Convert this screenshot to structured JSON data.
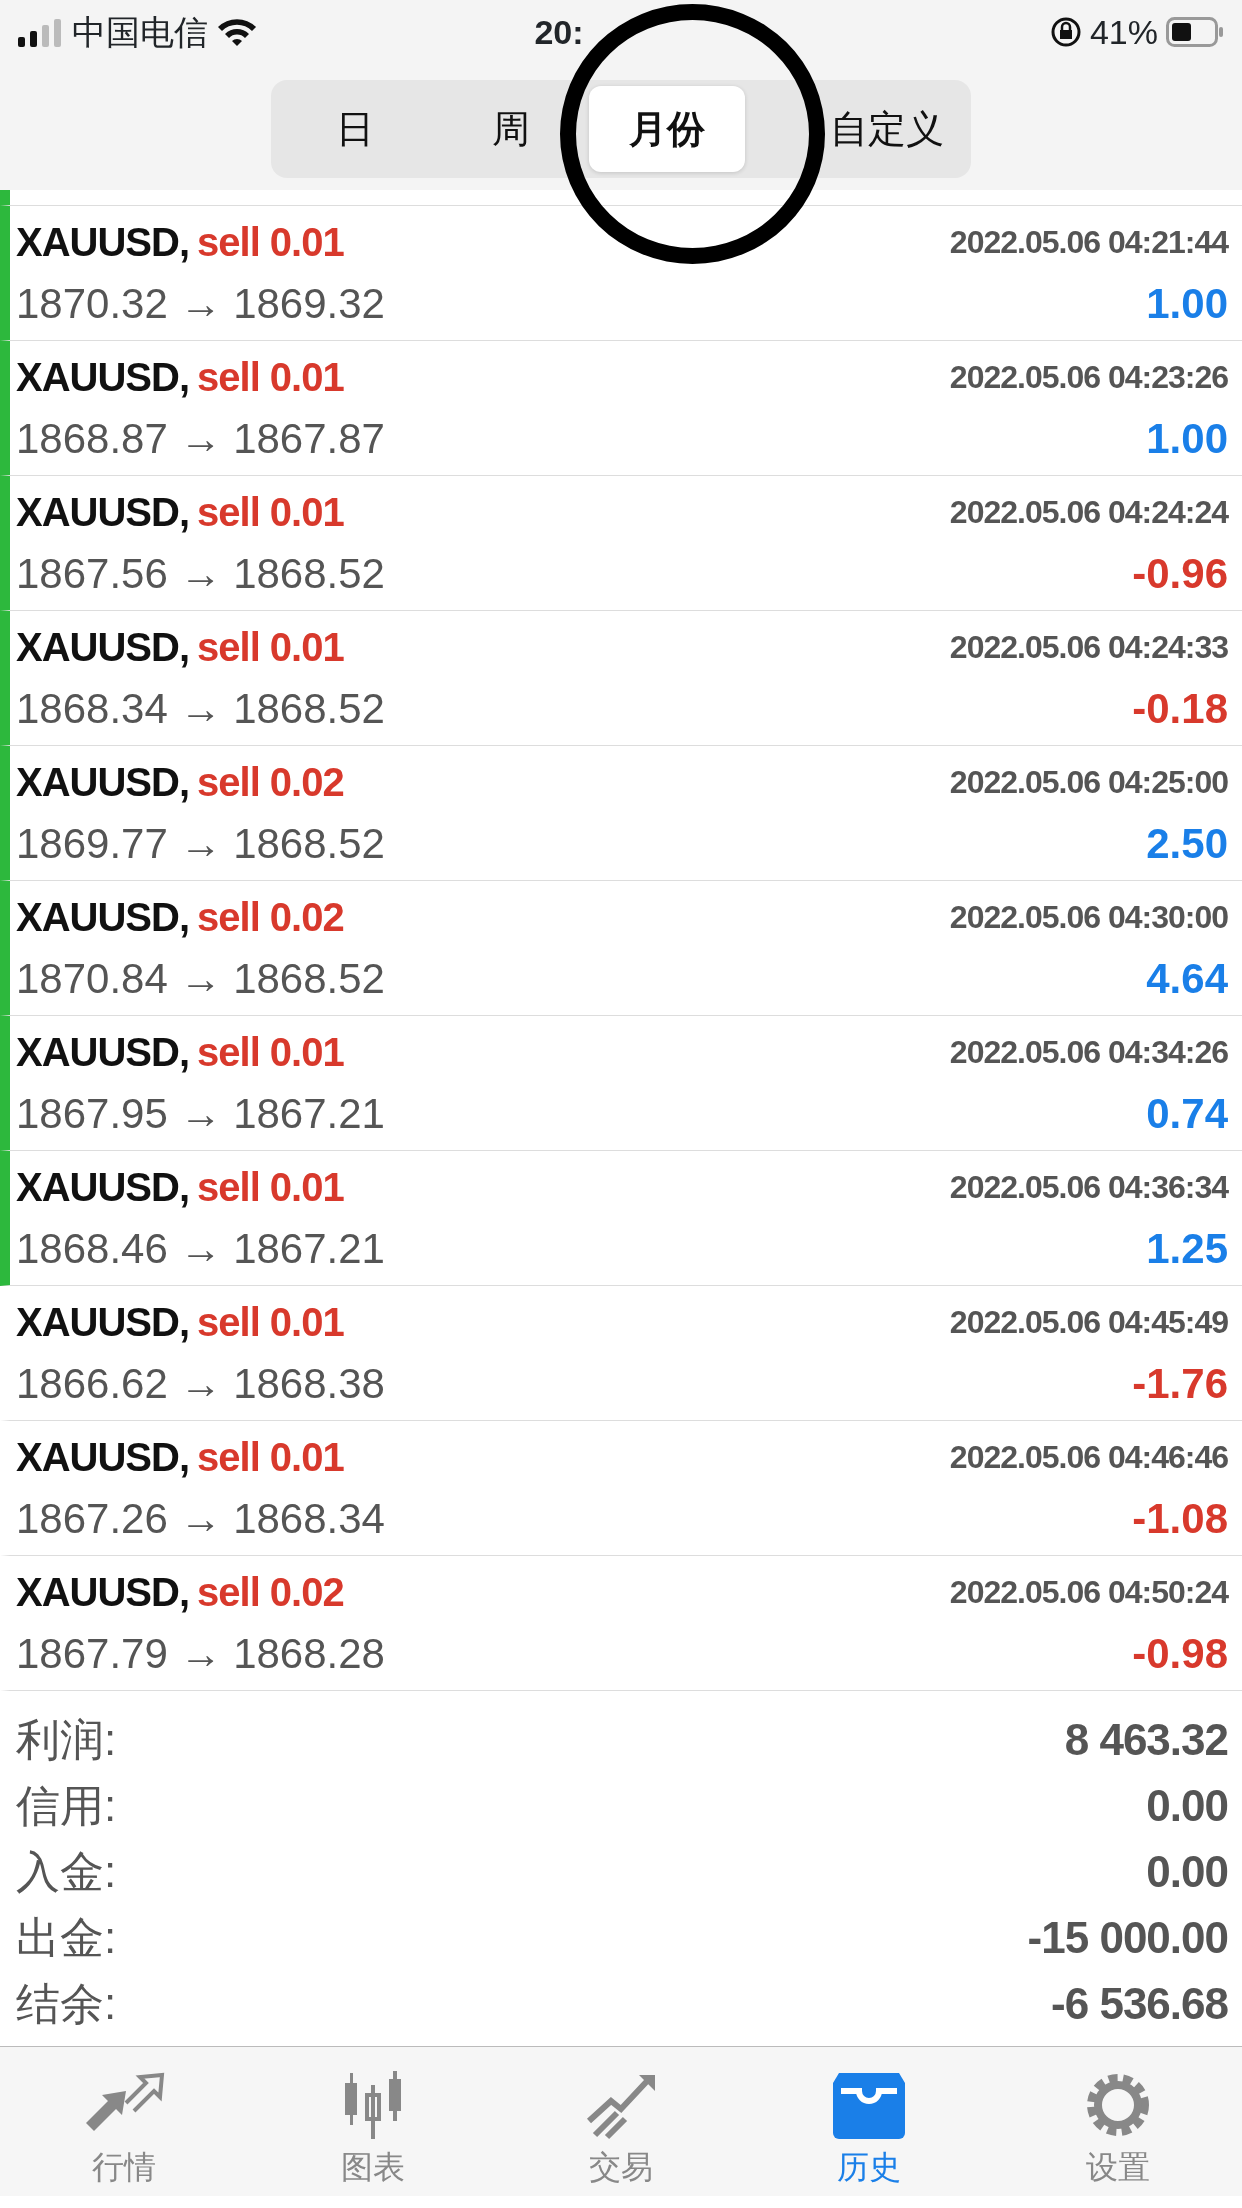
{
  "status_bar": {
    "carrier": "中国电信",
    "time": "20:",
    "battery": "41%"
  },
  "segments": [
    {
      "label": "日",
      "selected": false
    },
    {
      "label": "周",
      "selected": false
    },
    {
      "label": "月份",
      "selected": true
    },
    {
      "label": "自定义",
      "selected": false
    }
  ],
  "annotation": {
    "kind": "circle"
  },
  "deals": [
    {
      "symbol": "XAUUSD,",
      "side": "sell 0.01",
      "time": "2022.05.06 04:21:44",
      "prices": "1870.32 → 1869.32",
      "profit": "1.00",
      "kind": "gain",
      "marked": true
    },
    {
      "symbol": "XAUUSD,",
      "side": "sell 0.01",
      "time": "2022.05.06 04:23:26",
      "prices": "1868.87 → 1867.87",
      "profit": "1.00",
      "kind": "gain",
      "marked": true
    },
    {
      "symbol": "XAUUSD,",
      "side": "sell 0.01",
      "time": "2022.05.06 04:24:24",
      "prices": "1867.56 → 1868.52",
      "profit": "-0.96",
      "kind": "loss",
      "marked": true
    },
    {
      "symbol": "XAUUSD,",
      "side": "sell 0.01",
      "time": "2022.05.06 04:24:33",
      "prices": "1868.34 → 1868.52",
      "profit": "-0.18",
      "kind": "loss",
      "marked": true
    },
    {
      "symbol": "XAUUSD,",
      "side": "sell 0.02",
      "time": "2022.05.06 04:25:00",
      "prices": "1869.77 → 1868.52",
      "profit": "2.50",
      "kind": "gain",
      "marked": true
    },
    {
      "symbol": "XAUUSD,",
      "side": "sell 0.02",
      "time": "2022.05.06 04:30:00",
      "prices": "1870.84 → 1868.52",
      "profit": "4.64",
      "kind": "gain",
      "marked": true
    },
    {
      "symbol": "XAUUSD,",
      "side": "sell 0.01",
      "time": "2022.05.06 04:34:26",
      "prices": "1867.95 → 1867.21",
      "profit": "0.74",
      "kind": "gain",
      "marked": true
    },
    {
      "symbol": "XAUUSD,",
      "side": "sell 0.01",
      "time": "2022.05.06 04:36:34",
      "prices": "1868.46 → 1867.21",
      "profit": "1.25",
      "kind": "gain",
      "marked": true
    },
    {
      "symbol": "XAUUSD,",
      "side": "sell 0.01",
      "time": "2022.05.06 04:45:49",
      "prices": "1866.62 → 1868.38",
      "profit": "-1.76",
      "kind": "loss",
      "marked": false
    },
    {
      "symbol": "XAUUSD,",
      "side": "sell 0.01",
      "time": "2022.05.06 04:46:46",
      "prices": "1867.26 → 1868.34",
      "profit": "-1.08",
      "kind": "loss",
      "marked": false
    },
    {
      "symbol": "XAUUSD,",
      "side": "sell 0.02",
      "time": "2022.05.06 04:50:24",
      "prices": "1867.79 → 1868.28",
      "profit": "-0.98",
      "kind": "loss",
      "marked": false
    }
  ],
  "summary": [
    {
      "label": "利润:",
      "value": "8 463.32"
    },
    {
      "label": "信用:",
      "value": "0.00"
    },
    {
      "label": "入金:",
      "value": "0.00"
    },
    {
      "label": "出金:",
      "value": "-15 000.00"
    },
    {
      "label": "结余:",
      "value": "-6 536.68"
    }
  ],
  "tab_bar": [
    {
      "label": "行情",
      "kind": "quotes",
      "selected": false
    },
    {
      "label": "图表",
      "kind": "chart",
      "selected": false
    },
    {
      "label": "交易",
      "kind": "trade",
      "selected": false
    },
    {
      "label": "历史",
      "kind": "history",
      "selected": true
    },
    {
      "label": "设置",
      "kind": "settings",
      "selected": false
    }
  ]
}
